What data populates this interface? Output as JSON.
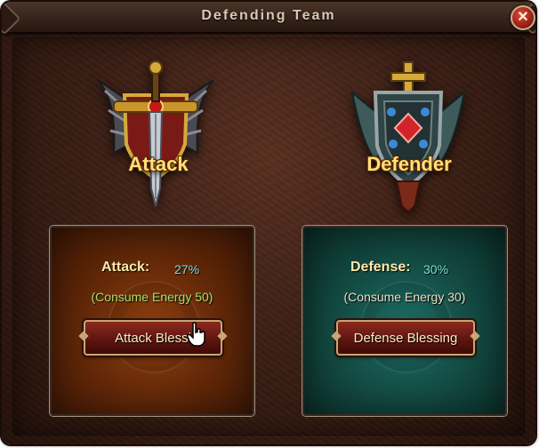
{
  "window": {
    "title": "Defending Team",
    "close_icon": "close-icon"
  },
  "attack": {
    "emblem_label": "Attack",
    "emblem_icon": "sword-shield-emblem-icon",
    "stat_label": "Attack:",
    "stat_value": "27%",
    "energy_text": "(Consume Energy 50)",
    "button_label": "Attack Blessing",
    "button_label_visible": "Attack Blessi"
  },
  "defense": {
    "emblem_label": "Defender",
    "emblem_icon": "cross-shield-emblem-icon",
    "stat_label": "Defense:",
    "stat_value": "30%",
    "energy_text": "(Consume Energy 30)",
    "button_label": "Defense Blessing"
  },
  "colors": {
    "attack_energy": "#a8e06a",
    "defense_energy": "#e8e0c8",
    "label_gold": "#ffe07a"
  },
  "cursor_icon": "hand-pointer-icon"
}
